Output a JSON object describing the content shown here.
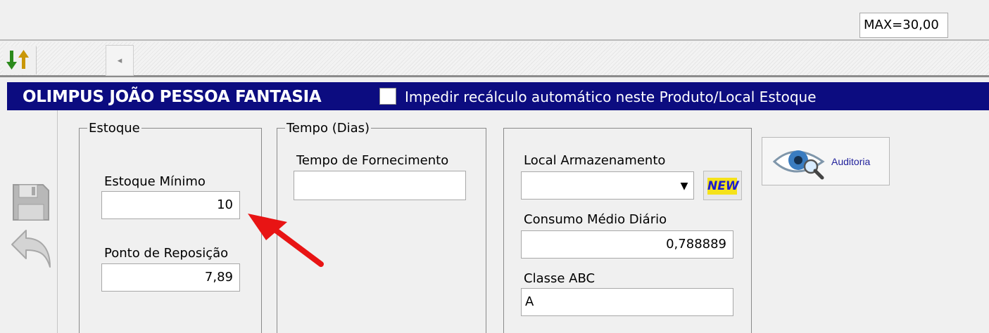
{
  "status": {
    "max_label": "MAX=30,00"
  },
  "toolbar": {
    "scroll_left_glyph": "◂"
  },
  "header": {
    "title": "OLIMPUS JOÃO PESSOA FANTASIA",
    "checkbox_label": "Impedir recálculo automático neste Produto/Local Estoque",
    "checkbox_checked": false
  },
  "estoque": {
    "group_label": "Estoque",
    "minimo_label": "Estoque Mínimo",
    "minimo_value": "10",
    "reposicao_label": "Ponto de Reposição",
    "reposicao_value": "7,89"
  },
  "tempo": {
    "group_label": "Tempo (Dias)",
    "fornecimento_label": "Tempo de Fornecimento",
    "fornecimento_value": ""
  },
  "armazenamento": {
    "local_label": "Local Armazenamento",
    "local_value": "",
    "new_label": "NEW",
    "consumo_label": "Consumo Médio Diário",
    "consumo_value": "0,788889",
    "classe_label": "Classe ABC",
    "classe_value": "A"
  },
  "auditoria": {
    "label": "Auditoria"
  },
  "icons": [
    "sort-arrows-icon",
    "save-icon",
    "undo-icon",
    "eye-magnifier-icon",
    "dropdown-arrow-icon"
  ],
  "colors": {
    "header_bg": "#0c0c80",
    "annotation_arrow": "#e81414",
    "new_bg": "#f5e21a",
    "new_text": "#1b1bd1"
  }
}
